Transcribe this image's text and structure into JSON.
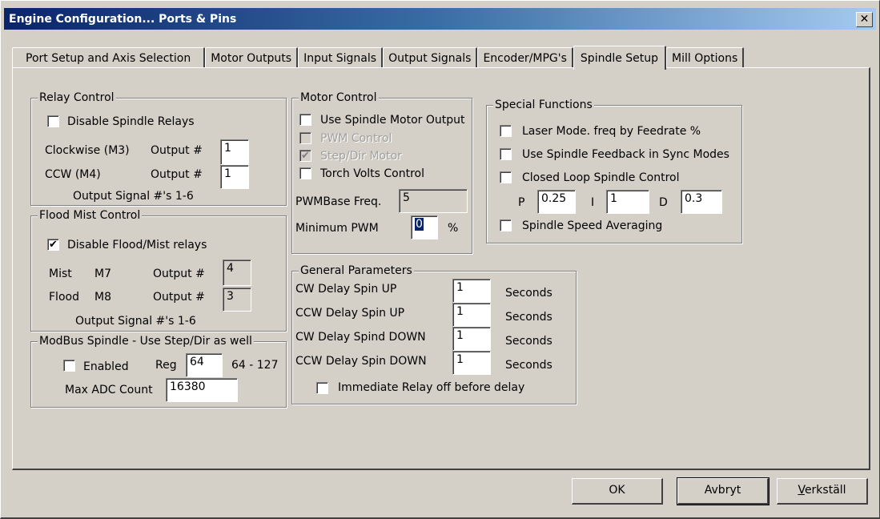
{
  "window": {
    "title": "Engine Configuration... Ports & Pins",
    "close_icon": "close-icon"
  },
  "tabs": [
    {
      "label": "Port Setup and Axis Selection",
      "active": false
    },
    {
      "label": "Motor Outputs",
      "active": false
    },
    {
      "label": "Input Signals",
      "active": false
    },
    {
      "label": "Output Signals",
      "active": false
    },
    {
      "label": "Encoder/MPG's",
      "active": false
    },
    {
      "label": "Spindle Setup",
      "active": true
    },
    {
      "label": "Mill Options",
      "active": false
    }
  ],
  "relay_control": {
    "title": "Relay Control",
    "disable_spindle_relays": {
      "label": "Disable Spindle Relays",
      "checked": false
    },
    "clockwise": {
      "label": "Clockwise (M3)",
      "output_label": "Output #",
      "value": "1"
    },
    "ccw": {
      "label": "CCW (M4)",
      "output_label": "Output #",
      "value": "1"
    },
    "note": "Output Signal #'s 1-6"
  },
  "flood_mist_control": {
    "title": "Flood Mist Control",
    "disable_flood_mist": {
      "label": "Disable Flood/Mist relays",
      "checked": true
    },
    "mist": {
      "label": "Mist",
      "code": "M7",
      "output_label": "Output #",
      "value": "4"
    },
    "flood": {
      "label": "Flood",
      "code": "M8",
      "output_label": "Output #",
      "value": "3"
    },
    "note": "Output Signal #'s 1-6"
  },
  "modbus_spindle": {
    "title": "ModBus Spindle - Use Step/Dir as well",
    "enabled": {
      "label": "Enabled",
      "checked": false
    },
    "reg_label": "Reg",
    "reg_value": "64",
    "reg_range": "64 - 127",
    "max_adc_label": "Max ADC Count",
    "max_adc_value": "16380"
  },
  "motor_control": {
    "title": "Motor Control",
    "use_spindle_motor_output": {
      "label": "Use Spindle Motor Output",
      "checked": false,
      "enabled": true
    },
    "pwm_control": {
      "label": "PWM Control",
      "checked": false,
      "enabled": false
    },
    "step_dir_motor": {
      "label": "Step/Dir Motor",
      "checked": true,
      "enabled": false
    },
    "torch_volts_control": {
      "label": "Torch Volts Control",
      "checked": false,
      "enabled": true
    },
    "pwm_base_freq_label": "PWMBase Freq.",
    "pwm_base_freq_value": "5",
    "minimum_pwm_label": "Minimum PWM",
    "minimum_pwm_value": "0",
    "minimum_pwm_unit": "%"
  },
  "special_functions": {
    "title": "Special Functions",
    "laser_mode": {
      "label": "Laser Mode. freq by Feedrate %",
      "checked": false
    },
    "spindle_feedback": {
      "label": "Use Spindle Feedback in Sync Modes",
      "checked": false
    },
    "closed_loop": {
      "label": "Closed Loop Spindle Control",
      "checked": false
    },
    "p_label": "P",
    "p_value": "0.25",
    "i_label": "I",
    "i_value": "1",
    "d_label": "D",
    "d_value": "0.3",
    "speed_averaging": {
      "label": "Spindle Speed Averaging",
      "checked": false
    }
  },
  "general_parameters": {
    "title": "General Parameters",
    "rows": [
      {
        "label": "CW Delay Spin UP",
        "value": "1",
        "unit": "Seconds"
      },
      {
        "label": "CCW Delay Spin UP",
        "value": "1",
        "unit": "Seconds"
      },
      {
        "label": "CW Delay Spind DOWN",
        "value": "1",
        "unit": "Seconds"
      },
      {
        "label": "CCW Delay Spin DOWN",
        "value": "1",
        "unit": "Seconds"
      }
    ],
    "immediate_relay_off": {
      "label": "Immediate Relay off before delay",
      "checked": false
    }
  },
  "buttons": {
    "ok": "OK",
    "cancel": "Avbryt",
    "apply_accel": "V",
    "apply_rest": "erkställ"
  }
}
